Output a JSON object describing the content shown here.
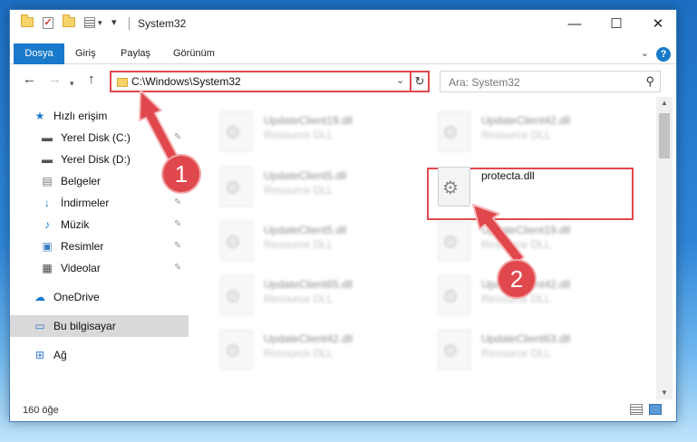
{
  "window": {
    "title": "System32",
    "quick_access_dropdown": "▾",
    "controls": {
      "minimize": "—",
      "maximize": "☐",
      "close": "✕"
    }
  },
  "ribbon": {
    "tabs": [
      "Dosya",
      "Giriş",
      "Paylaş",
      "Görünüm"
    ],
    "help": "?"
  },
  "navigation": {
    "back": "←",
    "forward": "→",
    "recent": "▾",
    "up": "↑",
    "address": "C:\\Windows\\System32",
    "refresh": "↻",
    "search_placeholder": "Ara: System32"
  },
  "sidebar": {
    "quick_access": "Hızlı erişim",
    "items": [
      {
        "label": "Yerel Disk (C:)",
        "icon": "drive-icon",
        "pinned": true
      },
      {
        "label": "Yerel Disk (D:)",
        "icon": "drive-icon",
        "pinned": true
      },
      {
        "label": "Belgeler",
        "icon": "documents-icon",
        "pinned": true
      },
      {
        "label": "İndirmeler",
        "icon": "downloads-icon",
        "pinned": true
      },
      {
        "label": "Müzik",
        "icon": "music-icon",
        "pinned": true
      },
      {
        "label": "Resimler",
        "icon": "pictures-icon",
        "pinned": true
      },
      {
        "label": "Videolar",
        "icon": "videos-icon",
        "pinned": true
      }
    ],
    "onedrive": "OneDrive",
    "this_pc": "Bu bilgisayar",
    "network": "Ağ"
  },
  "files": [
    {
      "name": "UpdateClient19.dll",
      "type": "Resource DLL",
      "blurred": true
    },
    {
      "name": "UpdateClient42.dll",
      "type": "Resource DLL",
      "blurred": true
    },
    {
      "name": "UpdateClient5.dll",
      "type": "Resource DLL",
      "blurred": true
    },
    {
      "name": "protecta.dll",
      "type": "",
      "blurred": false,
      "highlighted": true
    },
    {
      "name": "UpdateClient5.dll",
      "type": "Resource DLL",
      "blurred": true
    },
    {
      "name": "UpdateClient19.dll",
      "type": "Resource DLL",
      "blurred": true
    },
    {
      "name": "UpdateClient65.dll",
      "type": "Resource DLL",
      "blurred": true
    },
    {
      "name": "UpdateClient42.dll",
      "type": "Resource DLL",
      "blurred": true
    },
    {
      "name": "UpdateClient42.dll",
      "type": "Resource DLL",
      "blurred": true
    },
    {
      "name": "UpdateClient63.dll",
      "type": "Resource DLL",
      "blurred": true
    }
  ],
  "status": {
    "item_count": "160 öğe"
  },
  "annotations": {
    "step1": "1",
    "step2": "2",
    "color": "#e0484e"
  }
}
